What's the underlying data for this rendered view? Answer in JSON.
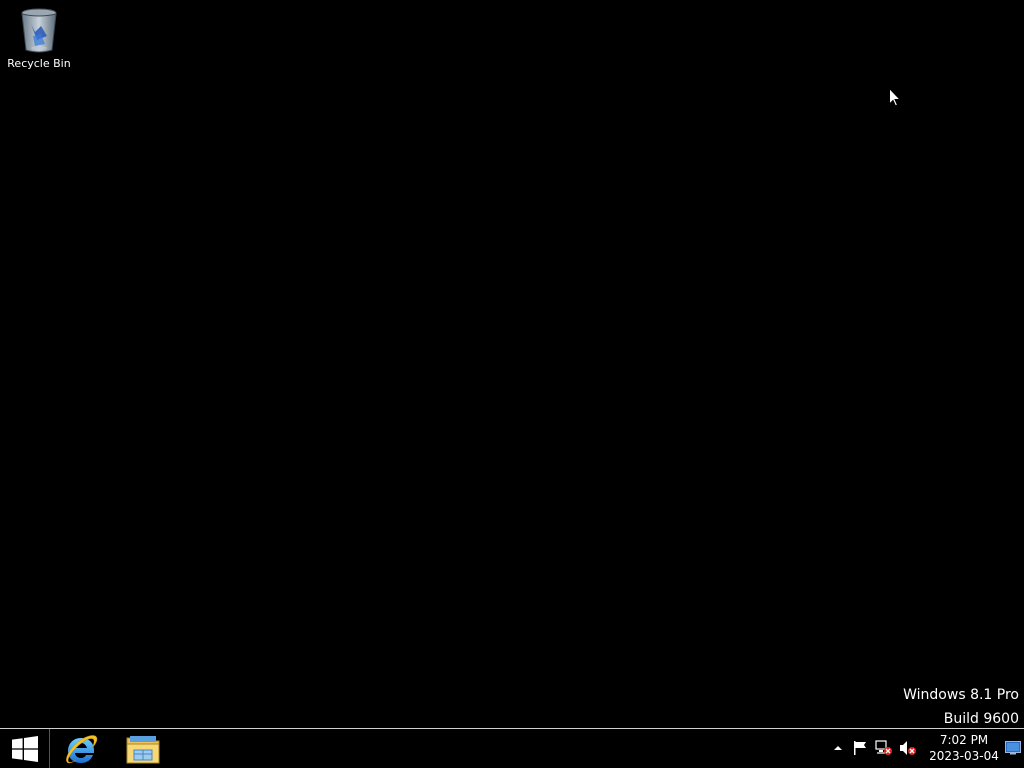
{
  "desktop": {
    "background_color": "#000000",
    "icons": [
      {
        "label": "Recycle Bin",
        "icon": "recycle-bin-icon"
      }
    ],
    "watermark": {
      "line1": "Windows 8.1 Pro",
      "line2": "Build 9600"
    }
  },
  "taskbar": {
    "start_icon": "windows-logo-icon",
    "pinned": [
      {
        "icon": "internet-explorer-icon"
      },
      {
        "icon": "file-explorer-icon"
      }
    ],
    "tray": {
      "icons": [
        "show-hidden-icons-arrow",
        "action-center-flag-icon",
        "network-disconnected-icon",
        "volume-muted-icon"
      ],
      "time": "7:02 PM",
      "date": "2023-03-04"
    },
    "show_desktop_icon": "show-desktop-icon"
  }
}
